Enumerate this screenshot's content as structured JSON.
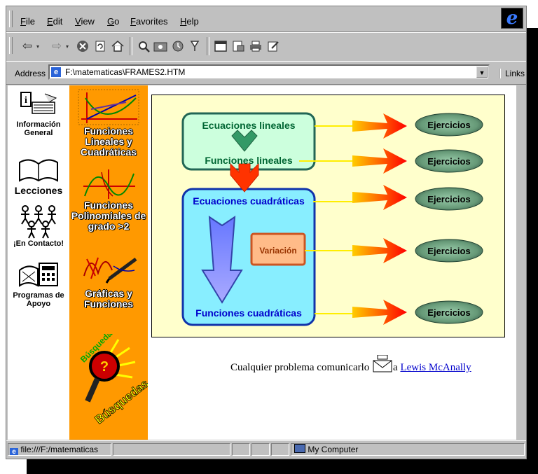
{
  "menu": [
    "File",
    "Edit",
    "View",
    "Go",
    "Favorites",
    "Help"
  ],
  "toolbar": {
    "icons": [
      "back-arrow-icon",
      "forward-arrow-icon",
      "stop-icon",
      "refresh-icon",
      "home-icon",
      "search-icon",
      "favorites-icon",
      "history-icon",
      "channels-icon",
      "fullscreen-icon",
      "mail-icon",
      "print-icon",
      "edit-icon"
    ]
  },
  "address": {
    "label": "Address",
    "value": "F:\\matematicas\\FRAMES2.HTM",
    "links": "Links"
  },
  "left_nav": [
    {
      "label": "Información General"
    },
    {
      "label": "Lecciones"
    },
    {
      "label": "¡En Contacto!"
    },
    {
      "label": "Programas de Apoyo"
    }
  ],
  "orange_nav": [
    {
      "label": "Funciones Lineales y Cuadráticas"
    },
    {
      "label": "Funciones Polinomiales de grado >2"
    },
    {
      "label": "Gráficas y Funciones"
    },
    {
      "label": "Búsquedas",
      "arc_label": "Búsqueda"
    }
  ],
  "diagram": {
    "linear_top": "Ecuaciones lineales",
    "linear_bottom": "Funciones lineales",
    "quad_top": "Ecuaciones cuadráticas",
    "variation": "Variación",
    "quad_bottom": "Funciones cuadráticas",
    "exercise": "Ejercicios"
  },
  "contact": {
    "text": "Cualquier problema comunicarlo",
    "pre": "a",
    "link": "Lewis McAnally"
  },
  "status": {
    "url": "file:///F:/matematicas",
    "zone": "My Computer"
  }
}
